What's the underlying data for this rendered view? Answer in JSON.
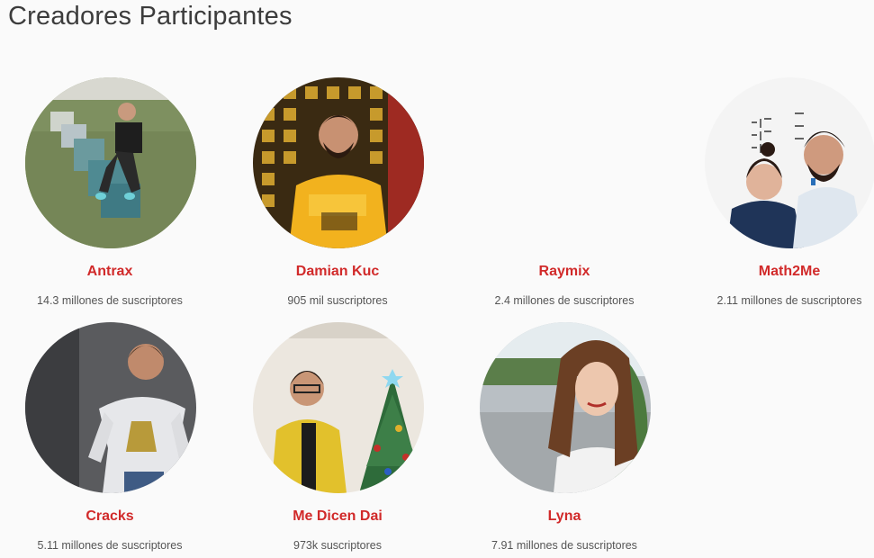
{
  "page": {
    "title": "Creadores Participantes"
  },
  "colors": {
    "background": "#fafafa",
    "title": "#3c3c3c",
    "name": "#d12a2a",
    "subscribers": "#555555"
  },
  "creators": [
    {
      "name": "Antrax",
      "subscribers": "14.3 millones de suscriptores",
      "photo": "man seated on mossy stone blocks on grass"
    },
    {
      "name": "Damian Kuc",
      "subscribers": "905 mil suscriptores",
      "photo": "man in yellow sweatshirt before lattice wall"
    },
    {
      "name": "Raymix",
      "subscribers": "2.4 millones de suscriptores",
      "photo": ""
    },
    {
      "name": "Math2Me",
      "subscribers": "2.11 millones de suscriptores",
      "photo": "woman and man in front of whiteboard with math"
    },
    {
      "name": "Cracks",
      "subscribers": "5.11 millones de suscriptores",
      "photo": "man in white printed sweater before grey wall"
    },
    {
      "name": "Me Dicen Dai",
      "subscribers": "973k suscriptores",
      "photo": "man in yellow jacket next to christmas tree"
    },
    {
      "name": "Lyna",
      "subscribers": "7.91 millones de suscriptores",
      "photo": "woman with long hair on a street"
    }
  ]
}
